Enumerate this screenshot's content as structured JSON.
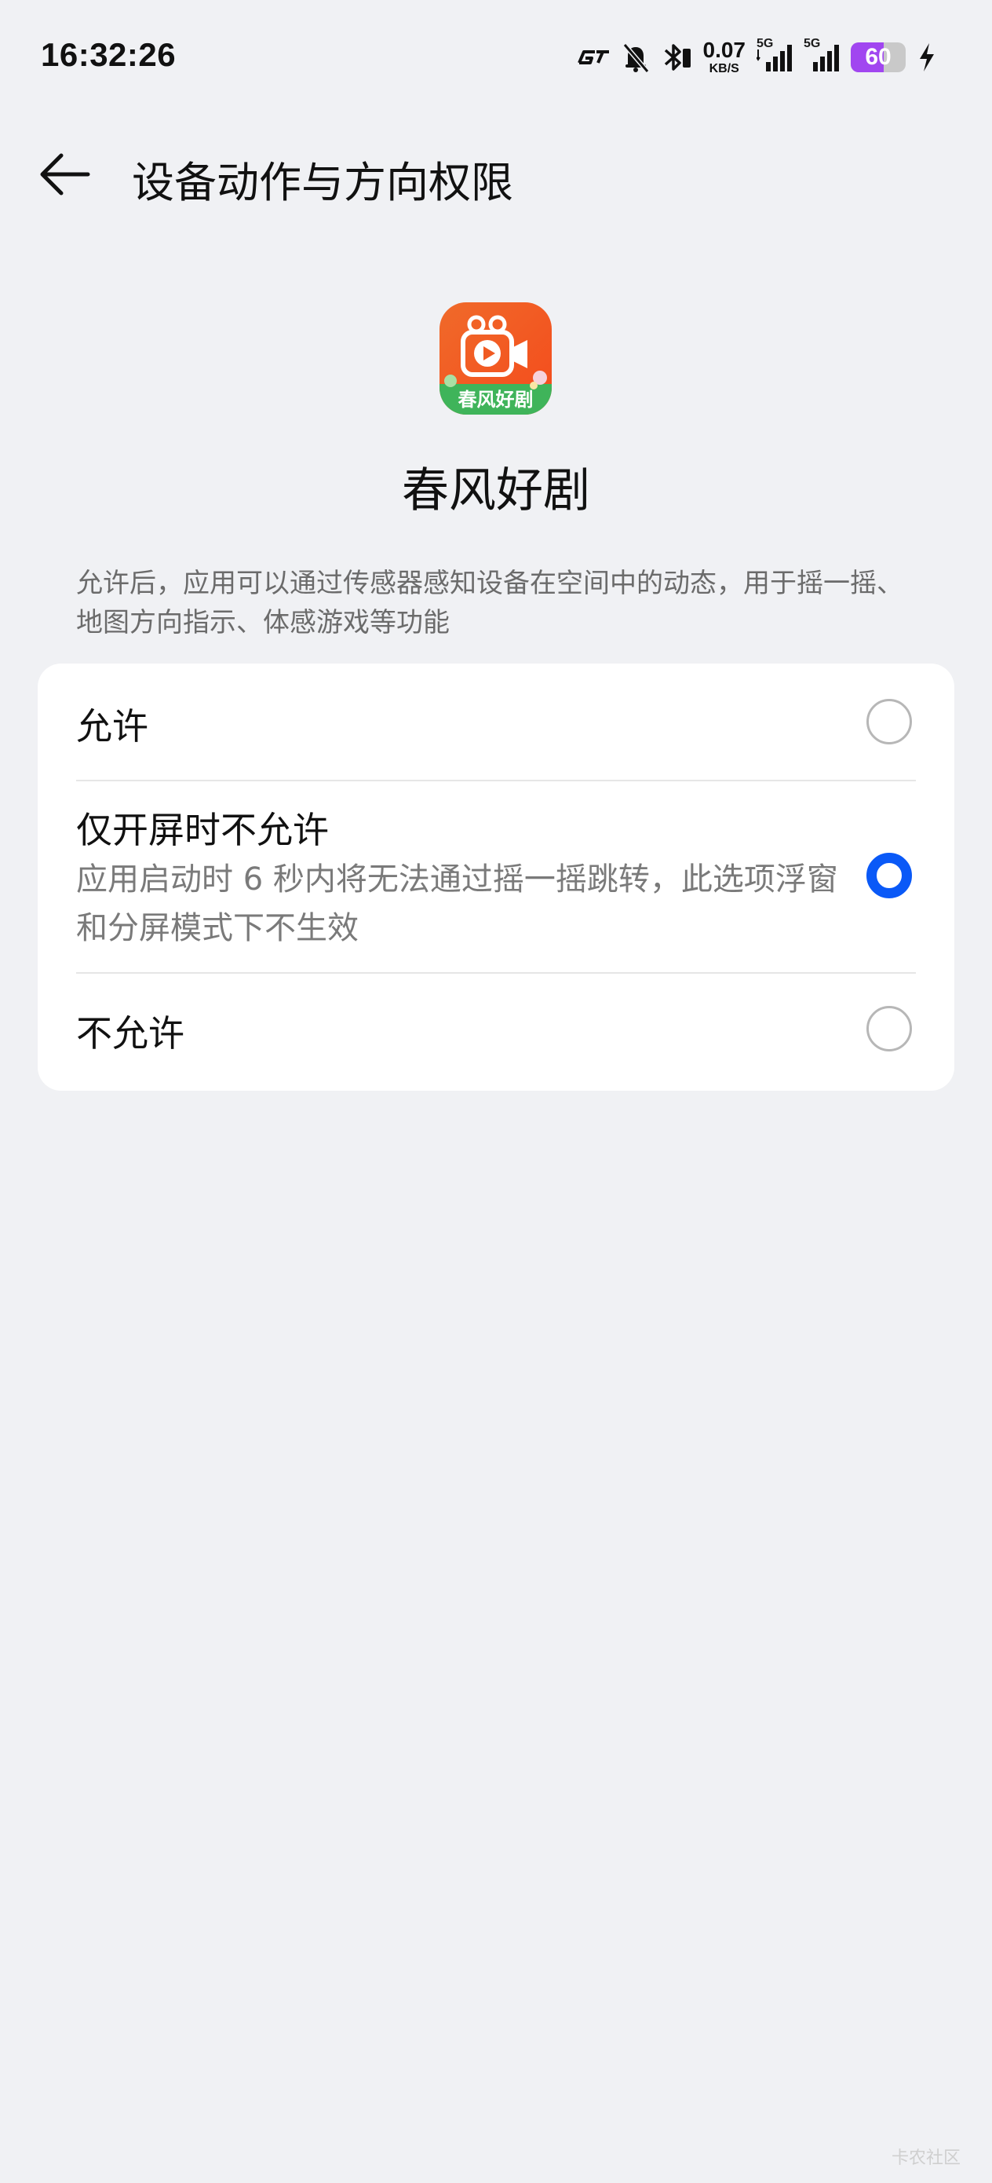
{
  "status_bar": {
    "time": "16:32:26",
    "net_speed_value": "0.07",
    "net_speed_unit": "KB/S",
    "signal1_label": "5G",
    "signal2_label": "5G",
    "battery_level": "60",
    "battery_percent": 60,
    "battery_color": "#a146f0",
    "icons": [
      "gt-icon",
      "bell-muted-icon",
      "bluetooth-icon",
      "signal-icon",
      "signal-icon",
      "battery-icon",
      "charging-icon"
    ]
  },
  "header": {
    "title": "设备动作与方向权限",
    "back_icon": "arrow-left-icon"
  },
  "app": {
    "name": "春风好剧",
    "icon_text": "春风好剧"
  },
  "description": "允许后，应用可以通过传感器感知设备在空间中的动态，用于摇一摇、地图方向指示、体感游戏等功能",
  "options": [
    {
      "title": "允许",
      "subtitle": "",
      "selected": false
    },
    {
      "title": "仅开屏时不允许",
      "subtitle": "应用启动时 6 秒内将无法通过摇一摇跳转，此选项浮窗和分屏模式下不生效",
      "selected": true
    },
    {
      "title": "不允许",
      "subtitle": "",
      "selected": false
    }
  ],
  "colors": {
    "background": "#f0f1f4",
    "card": "#ffffff",
    "accent": "#0a59f7"
  },
  "watermark": "卡农社区"
}
